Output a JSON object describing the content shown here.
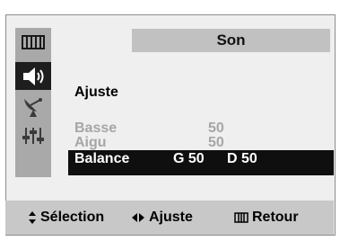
{
  "menu": {
    "title": "Son",
    "sidebar_icons": [
      "picture-icon",
      "speaker-icon",
      "antenna-icon",
      "settings-sliders-icon"
    ],
    "active_item": "speaker-icon",
    "header": "Ajuste",
    "items": [
      {
        "label": "Basse",
        "value": "50"
      },
      {
        "label": "Aigu",
        "value": "50"
      },
      {
        "label": "Balance",
        "value_left": "G 50",
        "value_right": "D 50"
      }
    ],
    "selected_item": "Balance"
  },
  "footer": {
    "selection": "Sélection",
    "adjust": "Ajuste",
    "back": "Retour"
  }
}
